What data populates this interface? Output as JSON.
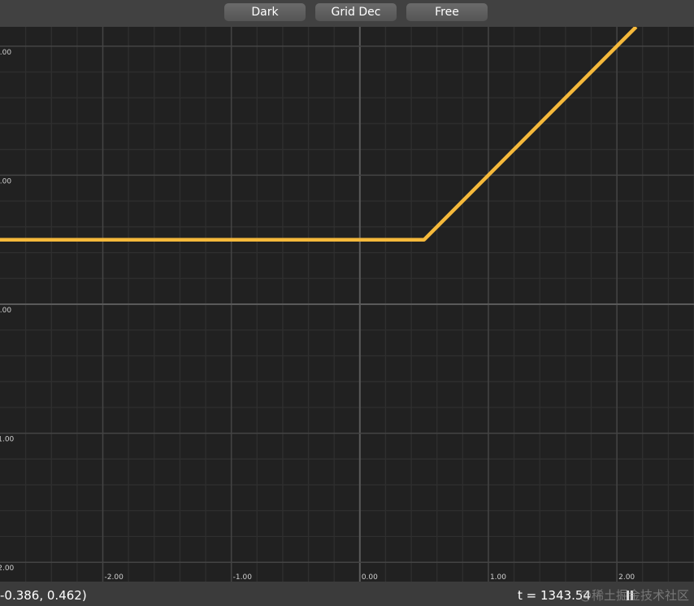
{
  "toolbar": {
    "theme_label": "Dark",
    "grid_label": "Grid Dec",
    "view_label": "Free"
  },
  "plot": {
    "x_ticks": [
      "-2.00",
      "-1.00",
      "0.00",
      "1.00",
      "2.00"
    ],
    "y_ticks": [
      "2.00",
      "1.00",
      "0.00",
      "-1.00",
      "-2.00"
    ],
    "curve_color": "#f5b93b",
    "grid": true
  },
  "chart_data": {
    "type": "line",
    "series": [
      {
        "x": [
          -2.8,
          0.5,
          2.15
        ],
        "y": [
          0.5,
          0.5,
          2.15
        ]
      }
    ],
    "xlim": [
      -2.8,
      2.6
    ],
    "ylim": [
      -2.15,
      2.15
    ],
    "grid": true
  },
  "status": {
    "coords": "-0.386, 0.462)",
    "time": "t = 1343.54",
    "watermark": "@稀土掘金技术社区"
  }
}
